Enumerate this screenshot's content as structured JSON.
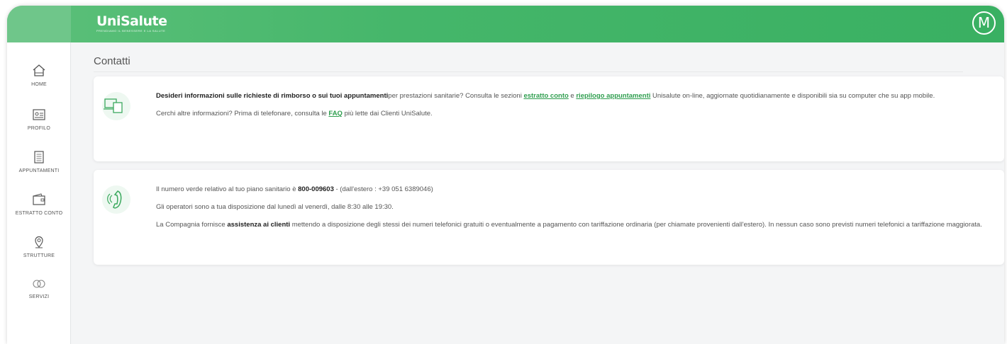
{
  "header": {
    "logo": "UniSalute",
    "logo_tagline": "PRENDIAMO IL BENESSERE E LA SALUTE",
    "avatar_initial": "M"
  },
  "sidebar": {
    "items": [
      {
        "label": "HOME",
        "icon": "home-icon"
      },
      {
        "label": "PROFILO",
        "icon": "profile-card-icon"
      },
      {
        "label": "APPUNTAMENTI",
        "icon": "calendar-icon"
      },
      {
        "label": "ESTRATTO CONTO",
        "icon": "wallet-icon"
      },
      {
        "label": "STRUTTURE",
        "icon": "location-pin-icon"
      },
      {
        "label": "SERVIZI",
        "icon": "services-icon"
      }
    ]
  },
  "page": {
    "title": "Contatti"
  },
  "info_card": {
    "icon": "devices-icon",
    "p1_bold": "Desideri informazioni sulle richieste di rimborso o sui tuoi appuntamenti",
    "p1_text": "per prestazioni sanitarie? Consulta le sezioni ",
    "link_estratto": "estratto conto",
    "p1_and": " e ",
    "link_riepilogo": "riepilogo appuntamenti",
    "p1_tail": " Unisalute on-line, aggiornate quotidianamente e disponibili sia su computer che su app mobile.",
    "p2_text": "Cerchi altre informazioni? Prima di telefonare, consulta le ",
    "link_faq": "FAQ",
    "p2_tail": " più lette dai Clienti UniSalute."
  },
  "phone_card": {
    "icon": "phone-icon",
    "p1_text": "Il numero verde relativo al tuo piano sanitario è ",
    "phone_number": "800-009603",
    "p1_tail": " - (dall'estero : +39 051 6389046)",
    "p2_text": "Gli operatori sono a tua disposizione dal lunedì al venerdì, dalle 8:30 alle 19:30.",
    "p3_text": "La Compagnia fornisce ",
    "p3_bold": "assistenza ai clienti",
    "p3_tail": " mettendo a disposizione degli stessi dei numeri telefonici gratuiti o eventualmente a pagamento con tariffazione ordinaria (per chiamate provenienti dall'estero). In nessun caso sono previsti numeri telefonici a tariffazione maggiorata."
  },
  "colors": {
    "brand_green": "#45b66a",
    "link_green": "#2f9e4f"
  }
}
